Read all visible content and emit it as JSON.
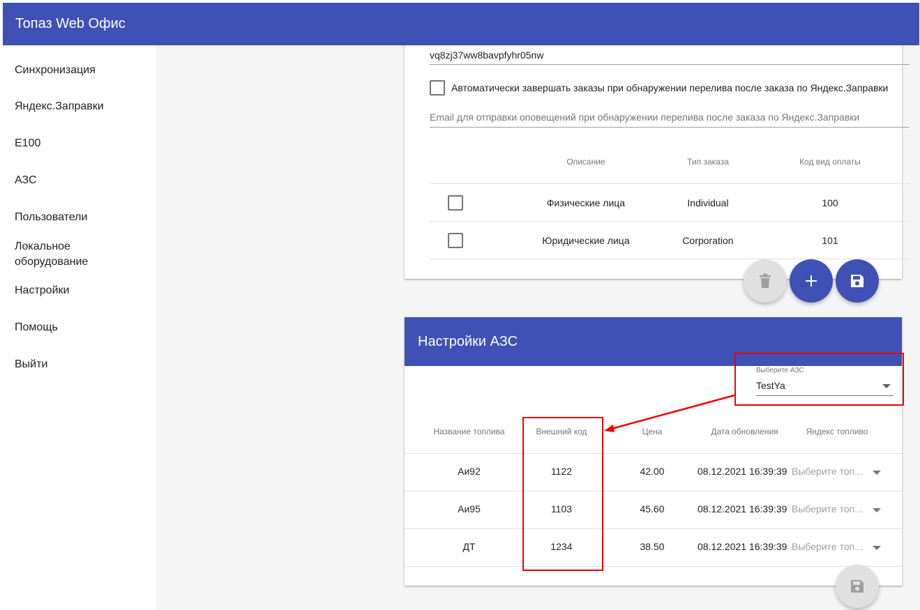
{
  "app": {
    "title": "Топаз Web Офис"
  },
  "sidebar": {
    "items": [
      {
        "label": "Синхронизация"
      },
      {
        "label": "Яндекс.Заправки"
      },
      {
        "label": "E100"
      },
      {
        "label": "АЗС"
      },
      {
        "label": "Пользователи"
      },
      {
        "label": "Локальное оборудование"
      },
      {
        "label": "Настройки"
      },
      {
        "label": "Помощь"
      },
      {
        "label": "Выйти"
      }
    ]
  },
  "yandex_card": {
    "token_value": "vq8zj37ww8bavpfyhr05nw",
    "auto_complete_label": "Автоматически завершать заказы при обнаружении перелива после заказа по Яндекс.Заправки",
    "auto_complete_checked": false,
    "email_placeholder": "Email для отправки оповещений при обнаружении перелива после заказа по Яндекс.Заправки",
    "table": {
      "headers": [
        "Описание",
        "Тип заказа",
        "Код вид оплаты"
      ],
      "rows": [
        {
          "checked": false,
          "description": "Физические лица",
          "order_type": "Individual",
          "payment_code": "100"
        },
        {
          "checked": false,
          "description": "Юридические лица",
          "order_type": "Corporation",
          "payment_code": "101"
        }
      ]
    },
    "fab_icons": {
      "delete": "trash-icon",
      "add": "plus-icon",
      "save": "floppy-disk-icon"
    }
  },
  "azs_card": {
    "title": "Настройки АЗС",
    "select": {
      "label": "Выберите АЗС",
      "value": "TestYa"
    },
    "table": {
      "headers": [
        "Название топлива",
        "Внешний код",
        "Цена",
        "Дата обновления",
        "Яндекс топливо"
      ],
      "rows": [
        {
          "fuel": "Аи92",
          "external_code": "1122",
          "price": "42.00",
          "updated": "08.12.2021 16:39:39",
          "yandex_fuel": "Выберите топ..."
        },
        {
          "fuel": "Аи95",
          "external_code": "1103",
          "price": "45.60",
          "updated": "08.12.2021 16:39:39",
          "yandex_fuel": "Выберите топ..."
        },
        {
          "fuel": "ДТ",
          "external_code": "1234",
          "price": "38.50",
          "updated": "08.12.2021 16:39:39",
          "yandex_fuel": "Выберите топ..."
        }
      ]
    },
    "fab_icons": {
      "save": "floppy-disk-icon"
    }
  },
  "colors": {
    "primary": "#3f51b5",
    "annotation": "#e00000",
    "background": "#f5f5f5"
  }
}
